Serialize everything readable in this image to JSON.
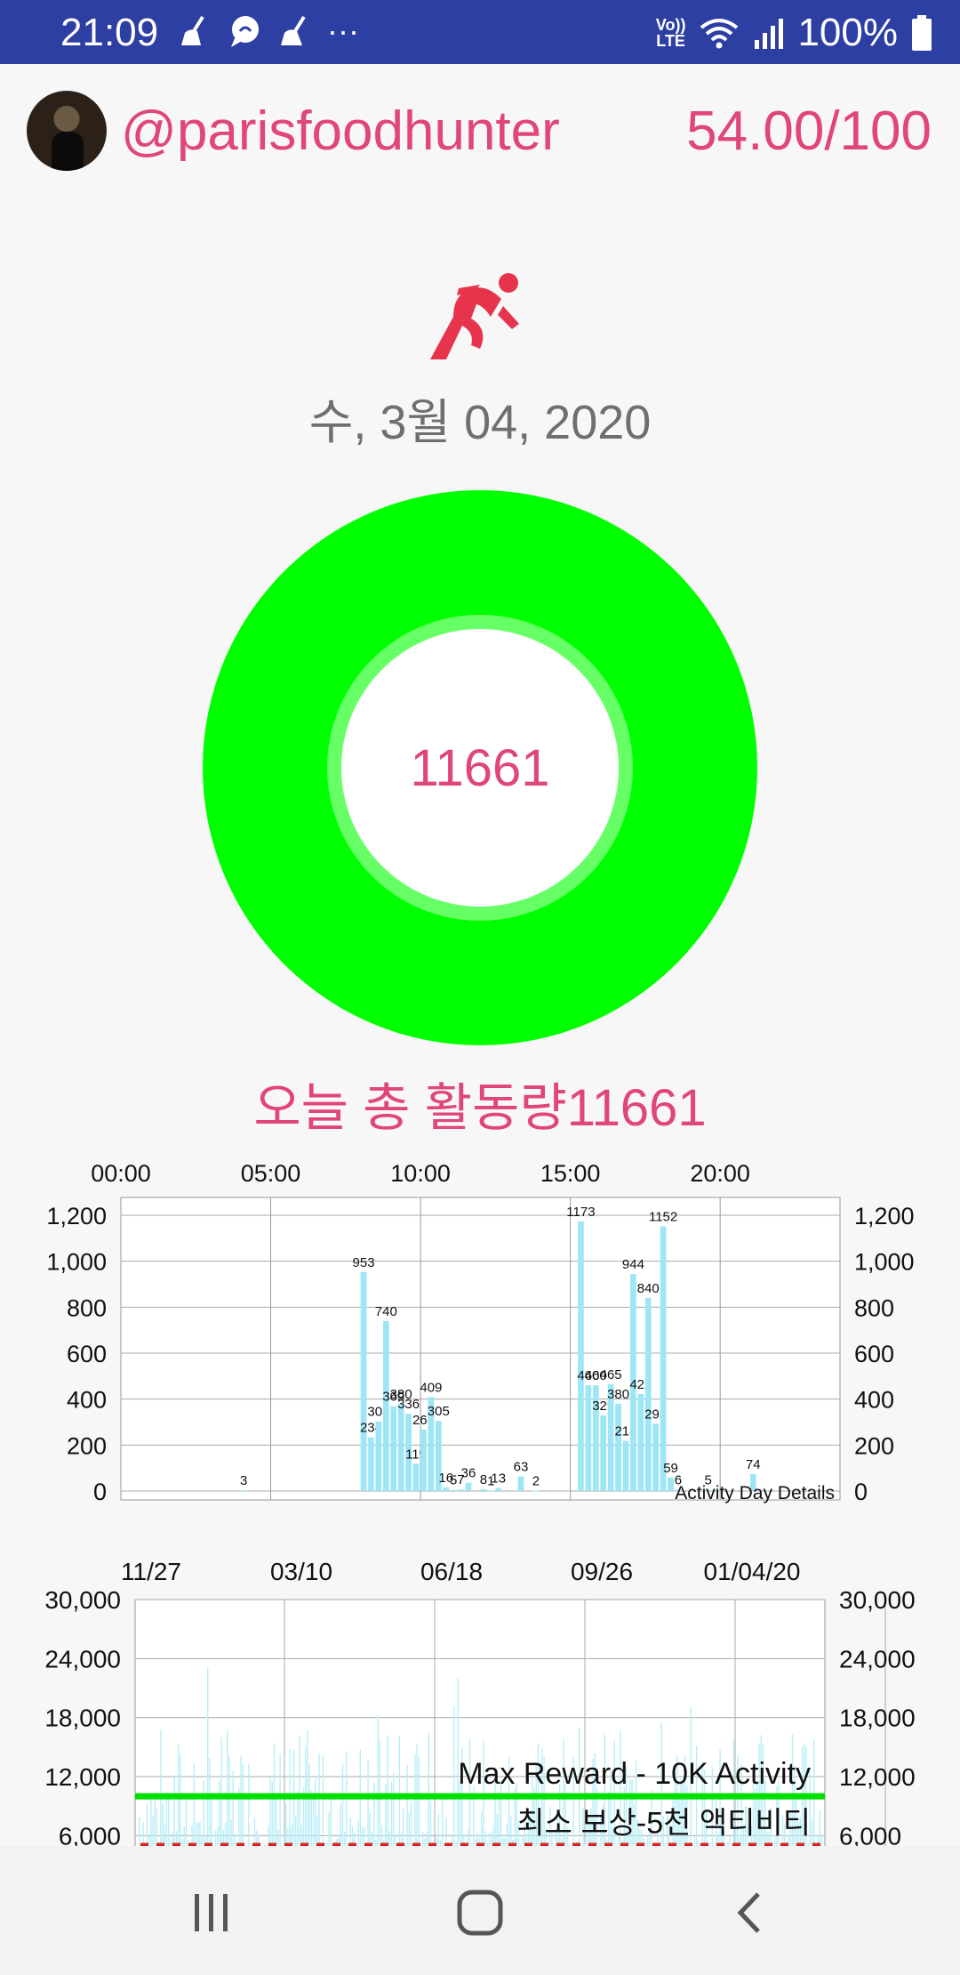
{
  "status_bar": {
    "time": "21:09",
    "dots": "···",
    "lte_top": "Vo))",
    "lte_bottom": "LTE",
    "battery": "100%"
  },
  "header": {
    "username": "@parisfoodhunter",
    "score": "54.00/100"
  },
  "date": "수, 3월 04, 2020",
  "ring": {
    "value": "11661",
    "outer_color": "#00ff00",
    "inner_color": "#66ff66"
  },
  "total_label": "오늘 총 활동량11661",
  "chart_data": [
    {
      "type": "bar",
      "title": "Activity Day Details",
      "x_ticks": [
        "00:00",
        "05:00",
        "10:00",
        "15:00",
        "20:00"
      ],
      "y_ticks": [
        "1,200",
        "1,000",
        "800",
        "600",
        "400",
        "200",
        "0"
      ],
      "ylim": [
        0,
        1200
      ],
      "xlim_hours": [
        0,
        24
      ],
      "bar_color": "#9ee6f5",
      "bars": [
        {
          "hour": 4.0,
          "value": 3
        },
        {
          "hour": 8.0,
          "value": 953
        },
        {
          "hour": 8.25,
          "value": 234
        },
        {
          "hour": 8.5,
          "value": 303
        },
        {
          "hour": 8.75,
          "value": 740
        },
        {
          "hour": 9.0,
          "value": 369
        },
        {
          "hour": 9.25,
          "value": 380
        },
        {
          "hour": 9.5,
          "value": 336
        },
        {
          "hour": 9.75,
          "value": 119
        },
        {
          "hour": 10.0,
          "value": 267
        },
        {
          "hour": 10.25,
          "value": 409
        },
        {
          "hour": 10.5,
          "value": 305
        },
        {
          "hour": 10.75,
          "value": 16
        },
        {
          "hour": 11.0,
          "value": 5
        },
        {
          "hour": 11.25,
          "value": 7
        },
        {
          "hour": 11.5,
          "value": 36
        },
        {
          "hour": 12.0,
          "value": 8
        },
        {
          "hour": 12.25,
          "value": 1
        },
        {
          "hour": 12.5,
          "value": 13
        },
        {
          "hour": 13.25,
          "value": 63
        },
        {
          "hour": 13.75,
          "value": 2
        },
        {
          "hour": 15.25,
          "value": 1173
        },
        {
          "hour": 15.5,
          "value": 460
        },
        {
          "hour": 15.75,
          "value": 460
        },
        {
          "hour": 16.0,
          "value": 329
        },
        {
          "hour": 16.25,
          "value": 465
        },
        {
          "hour": 16.5,
          "value": 380
        },
        {
          "hour": 16.75,
          "value": 218
        },
        {
          "hour": 17.0,
          "value": 944
        },
        {
          "hour": 17.25,
          "value": 422
        },
        {
          "hour": 17.5,
          "value": 840
        },
        {
          "hour": 17.75,
          "value": 293
        },
        {
          "hour": 18.0,
          "value": 1152
        },
        {
          "hour": 18.25,
          "value": 59
        },
        {
          "hour": 18.5,
          "value": 6
        },
        {
          "hour": 19.5,
          "value": 5
        },
        {
          "hour": 21.0,
          "value": 74
        }
      ]
    },
    {
      "type": "bar",
      "title": "",
      "x_ticks": [
        "11/27",
        "03/10",
        "06/18",
        "09/26",
        "01/04/20"
      ],
      "y_ticks": [
        "30,000",
        "24,000",
        "18,000",
        "12,000",
        "6,000"
      ],
      "ylim": [
        4500,
        30000
      ],
      "bar_color": "#b9eef7",
      "reference_lines": [
        {
          "label": "Max Reward - 10K Activity",
          "value": 10000,
          "color": "#00e000",
          "style": "solid"
        },
        {
          "label": "최소 보상-5천 액티비티",
          "value": 5000,
          "color": "#e02020",
          "style": "dotted"
        }
      ]
    }
  ],
  "nav": {
    "recents": "recents-icon",
    "home": "home-icon",
    "back": "back-icon"
  }
}
